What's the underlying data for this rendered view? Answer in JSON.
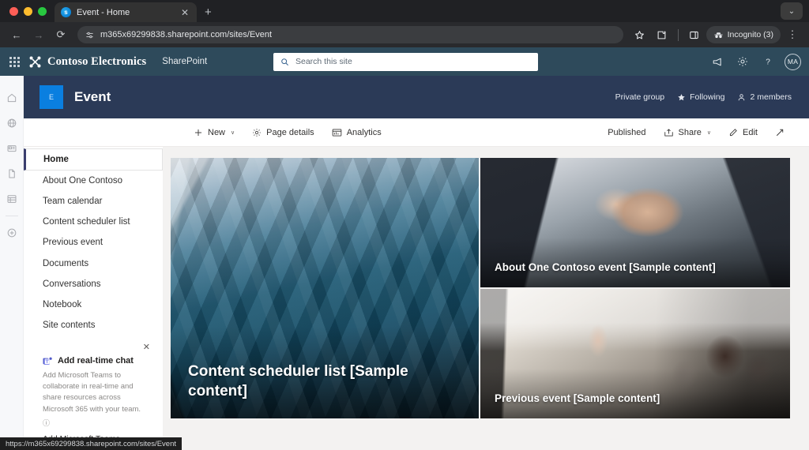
{
  "browser": {
    "tab": {
      "title": "Event - Home",
      "favicon": "sharepoint-icon",
      "close_label": "✕"
    },
    "new_tab_label": "+",
    "window_chevron": "⌄",
    "nav": {
      "back": "←",
      "forward": "→",
      "reload": "⟳"
    },
    "omnibox": {
      "url": "m365x69299838.sharepoint.com/sites/Event",
      "site_settings_icon": "tune-icon"
    },
    "actions": {
      "bookmark": "star-icon",
      "extensions": "extensions-icon",
      "side_panel": "side-panel-icon",
      "profile_label": "Incognito (3)",
      "menu": "⋮"
    },
    "status_bar": {
      "url": "https://m365x69299838.sharepoint.com/sites/Event"
    }
  },
  "suitebar": {
    "waffle": "app-launcher-icon",
    "brand": "Contoso Electronics",
    "app_name": "SharePoint",
    "search": {
      "placeholder": "Search this site",
      "icon": "search-icon"
    },
    "icons": {
      "feedback": "megaphone-icon",
      "settings": "gear-icon",
      "help": "question-mark-icon"
    },
    "avatar_initials": "MA"
  },
  "app_rail": {
    "items": [
      {
        "name": "home-icon",
        "label": "Home"
      },
      {
        "name": "globe-icon",
        "label": "Sites"
      },
      {
        "name": "news-icon",
        "label": "News"
      },
      {
        "name": "document-icon",
        "label": "Files"
      },
      {
        "name": "list-icon",
        "label": "Lists"
      },
      {
        "name": "create-icon",
        "label": "Create"
      }
    ]
  },
  "site_header": {
    "logo_letter": "E",
    "title": "Event",
    "privacy": "Private group",
    "following": {
      "label": "Following",
      "icon": "star-icon"
    },
    "members": {
      "label": "2 members",
      "icon": "people-icon"
    }
  },
  "command_bar": {
    "new": {
      "label": "New",
      "icon": "plus-icon",
      "chevron": "∨"
    },
    "page_details": {
      "label": "Page details",
      "icon": "gear-icon"
    },
    "analytics": {
      "label": "Analytics",
      "icon": "analytics-icon"
    },
    "published": "Published",
    "share": {
      "label": "Share",
      "icon": "share-icon",
      "chevron": "∨"
    },
    "edit": {
      "label": "Edit",
      "icon": "pencil-icon"
    },
    "expand": {
      "icon": "expand-icon"
    }
  },
  "left_nav": {
    "items": [
      {
        "label": "Home",
        "selected": true
      },
      {
        "label": "About One Contoso",
        "selected": false
      },
      {
        "label": "Team calendar",
        "selected": false
      },
      {
        "label": "Content scheduler list",
        "selected": false
      },
      {
        "label": "Previous event",
        "selected": false
      },
      {
        "label": "Documents",
        "selected": false
      },
      {
        "label": "Conversations",
        "selected": false
      },
      {
        "label": "Notebook",
        "selected": false
      },
      {
        "label": "Site contents",
        "selected": false
      }
    ]
  },
  "teams_card": {
    "close_icon": "close-icon",
    "logo": "teams-icon",
    "title": "Add real-time chat",
    "description": "Add Microsoft Teams to collaborate in real-time and share resources across Microsoft 365 with your team.",
    "info_icon": "info-icon",
    "link": "Add Microsoft Teams"
  },
  "hero": {
    "tiles": [
      {
        "caption": "Content scheduler list [Sample content]",
        "image": "glass-building-photo",
        "layout": "main"
      },
      {
        "caption": "About One Contoso event [Sample content]",
        "image": "handshake-photo",
        "layout": "side-top"
      },
      {
        "caption": "Previous event [Sample content]",
        "image": "presentation-audience-photo",
        "layout": "side-bottom"
      }
    ]
  },
  "colors": {
    "suitebar_bg": "#2e4a5b",
    "site_header_bg": "#2b3a57",
    "site_logo_bg": "#0a7fe0",
    "nav_accent": "#3b3f6e",
    "canvas_bg": "#f3f2f1"
  }
}
